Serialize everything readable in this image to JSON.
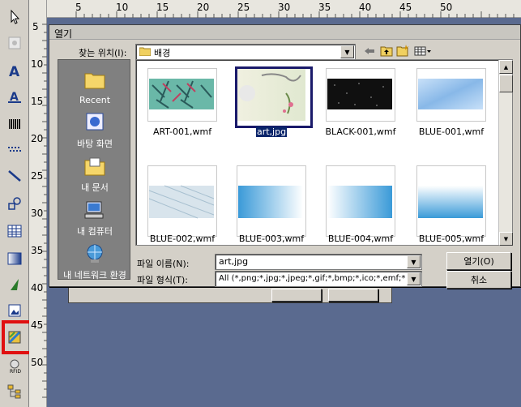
{
  "ruler": {
    "h": [
      "5",
      "10",
      "15",
      "20",
      "25",
      "30",
      "35",
      "40",
      "45",
      "50"
    ],
    "v": [
      "5",
      "10",
      "15",
      "20",
      "25",
      "30",
      "35",
      "40",
      "45",
      "50"
    ]
  },
  "toolbar": {
    "tools": [
      "pointer-tool-icon",
      "image-tool-icon",
      "text-tool-icon",
      "outline-text-tool-icon",
      "barcode-tool-icon",
      "dot-barcode-tool-icon",
      "line-tool-icon",
      "shape-tool-icon",
      "table-tool-icon",
      "gradient-tool-icon",
      "triangle-tool-icon",
      "picture-tool-icon",
      "image-insert-tool-icon",
      "rfid-tool-icon",
      "tree-tool-icon"
    ],
    "highlighted_tool": "image-insert-tool-icon",
    "highlight_color": "#e01010"
  },
  "dialog": {
    "title": "열기",
    "lookin_label": "찾는 위치(I):",
    "lookin_value": "배경",
    "places": [
      "Recent",
      "바탕 화면",
      "내 문서",
      "내 컴퓨터",
      "내 네트워크 환경"
    ],
    "files": [
      {
        "name": "ART-001,wmf",
        "selected": false
      },
      {
        "name": "art,jpg",
        "selected": true
      },
      {
        "name": "BLACK-001,wmf",
        "selected": false
      },
      {
        "name": "BLUE-001,wmf",
        "selected": false
      },
      {
        "name": "BLUE-002,wmf",
        "selected": false
      },
      {
        "name": "BLUE-003,wmf",
        "selected": false
      },
      {
        "name": "BLUE-004,wmf",
        "selected": false
      },
      {
        "name": "BLUE-005,wmf",
        "selected": false
      }
    ],
    "filename_label": "파일 이름(N):",
    "filename_value": "art,jpg",
    "filetype_label": "파일 형식(T):",
    "filetype_value": "All (*,png;*,jpg;*,jpeg;*,gif;*,bmp;*,ico;*,emf;*",
    "open_button": "열기(O)",
    "cancel_button": "취소"
  },
  "behind_dialog": {
    "buttons": [
      "",
      ""
    ]
  }
}
